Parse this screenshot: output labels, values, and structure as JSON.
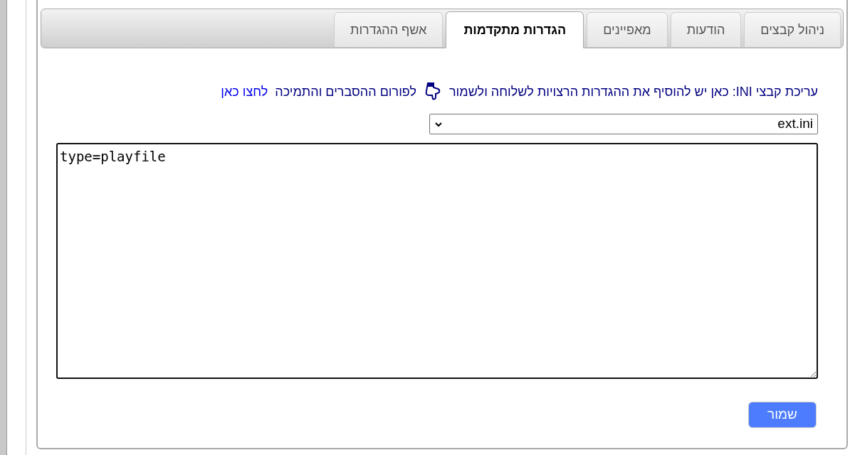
{
  "tabs": [
    {
      "label": "ניהול קבצים",
      "selected": false
    },
    {
      "label": "הודעות",
      "selected": false
    },
    {
      "label": "מאפיינים",
      "selected": false
    },
    {
      "label": "הגדרות מתקדמות",
      "selected": true
    },
    {
      "label": "אשף ההגדרות",
      "selected": false
    }
  ],
  "instruction": "עריכת קבצי INI: כאן יש להוסיף את ההגדרות הרצויות לשלוחה ולשמור",
  "forum_text": "לפורום ההסברים והתמיכה",
  "forum_link": "לחצו כאן",
  "file_select": {
    "value": "ext.ini"
  },
  "editor": {
    "value": "type=playfile"
  },
  "save_button": "שמור"
}
